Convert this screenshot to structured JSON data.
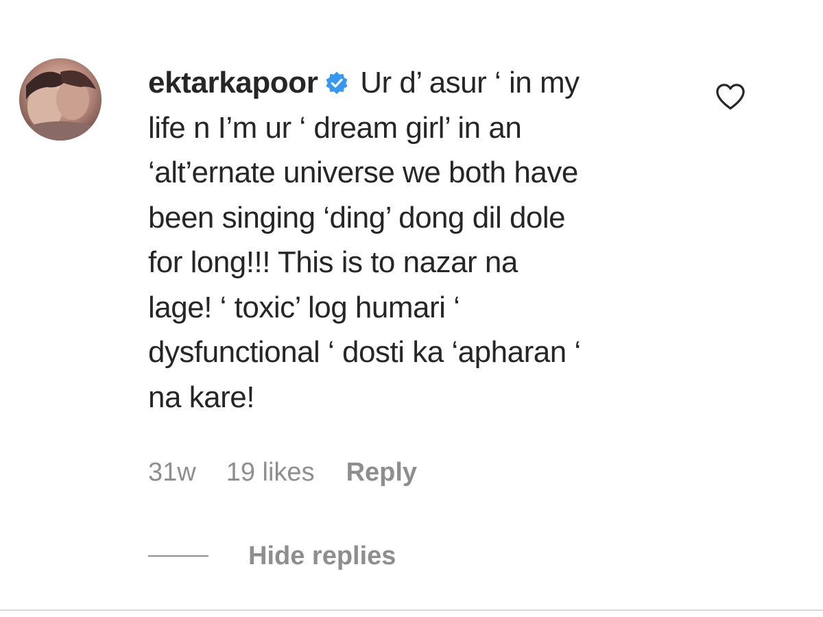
{
  "comment": {
    "username": "ektarkapoor",
    "verified_icon": "verified-badge-icon",
    "text_lines": [
      "Ur d’ asur ‘ in my",
      "life n I’m ur ‘ dream girl’ in an",
      "‘alt’ernate universe we both have",
      "been singing ‘ding’ dong dil dole",
      "for long!!! This is to nazar na",
      "lage! ‘ toxic’ log humari ‘",
      "dysfunctional ‘ dosti ka ‘apharan ‘",
      "na kare!"
    ],
    "like_icon": "heart-outline-icon",
    "time": "31w",
    "likes": "19 likes",
    "reply_label": "Reply",
    "hide_replies_label": "Hide replies"
  },
  "colors": {
    "text": "#262626",
    "secondary": "#8e8e8e",
    "verified": "#3897f0",
    "border": "#dbdbdb"
  }
}
